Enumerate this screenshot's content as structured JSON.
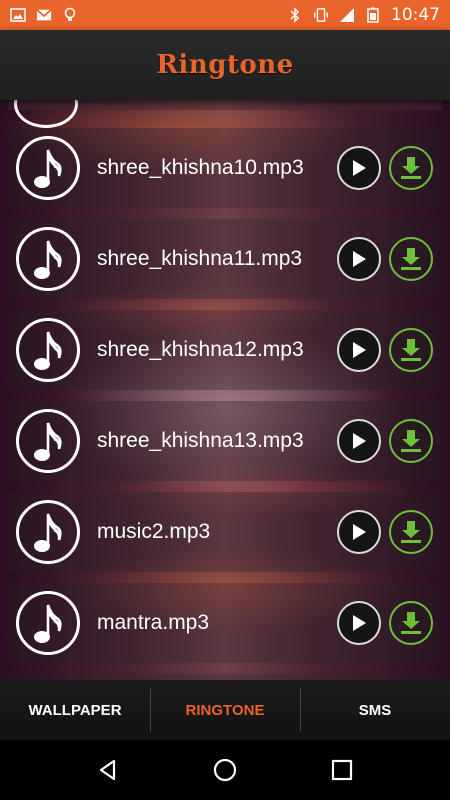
{
  "status_bar": {
    "time": "10:47",
    "left_icons": [
      "image-icon",
      "gmail-icon",
      "lightbulb-icon"
    ],
    "right_icons": [
      "bluetooth-icon",
      "vibrate-icon",
      "signal-icon",
      "battery-icon"
    ]
  },
  "app_bar": {
    "title": "Ringtone"
  },
  "ringtones": [
    {
      "name": "shree_khishna10.mp3"
    },
    {
      "name": "shree_khishna11.mp3"
    },
    {
      "name": "shree_khishna12.mp3"
    },
    {
      "name": "shree_khishna13.mp3"
    },
    {
      "name": "music2.mp3"
    },
    {
      "name": "mantra.mp3"
    }
  ],
  "tabs": [
    {
      "label": "WALLPAPER",
      "active": false
    },
    {
      "label": "RINGTONE",
      "active": true
    },
    {
      "label": "SMS",
      "active": false
    }
  ],
  "colors": {
    "accent": "#e8642a",
    "download": "#6fbf3a"
  }
}
